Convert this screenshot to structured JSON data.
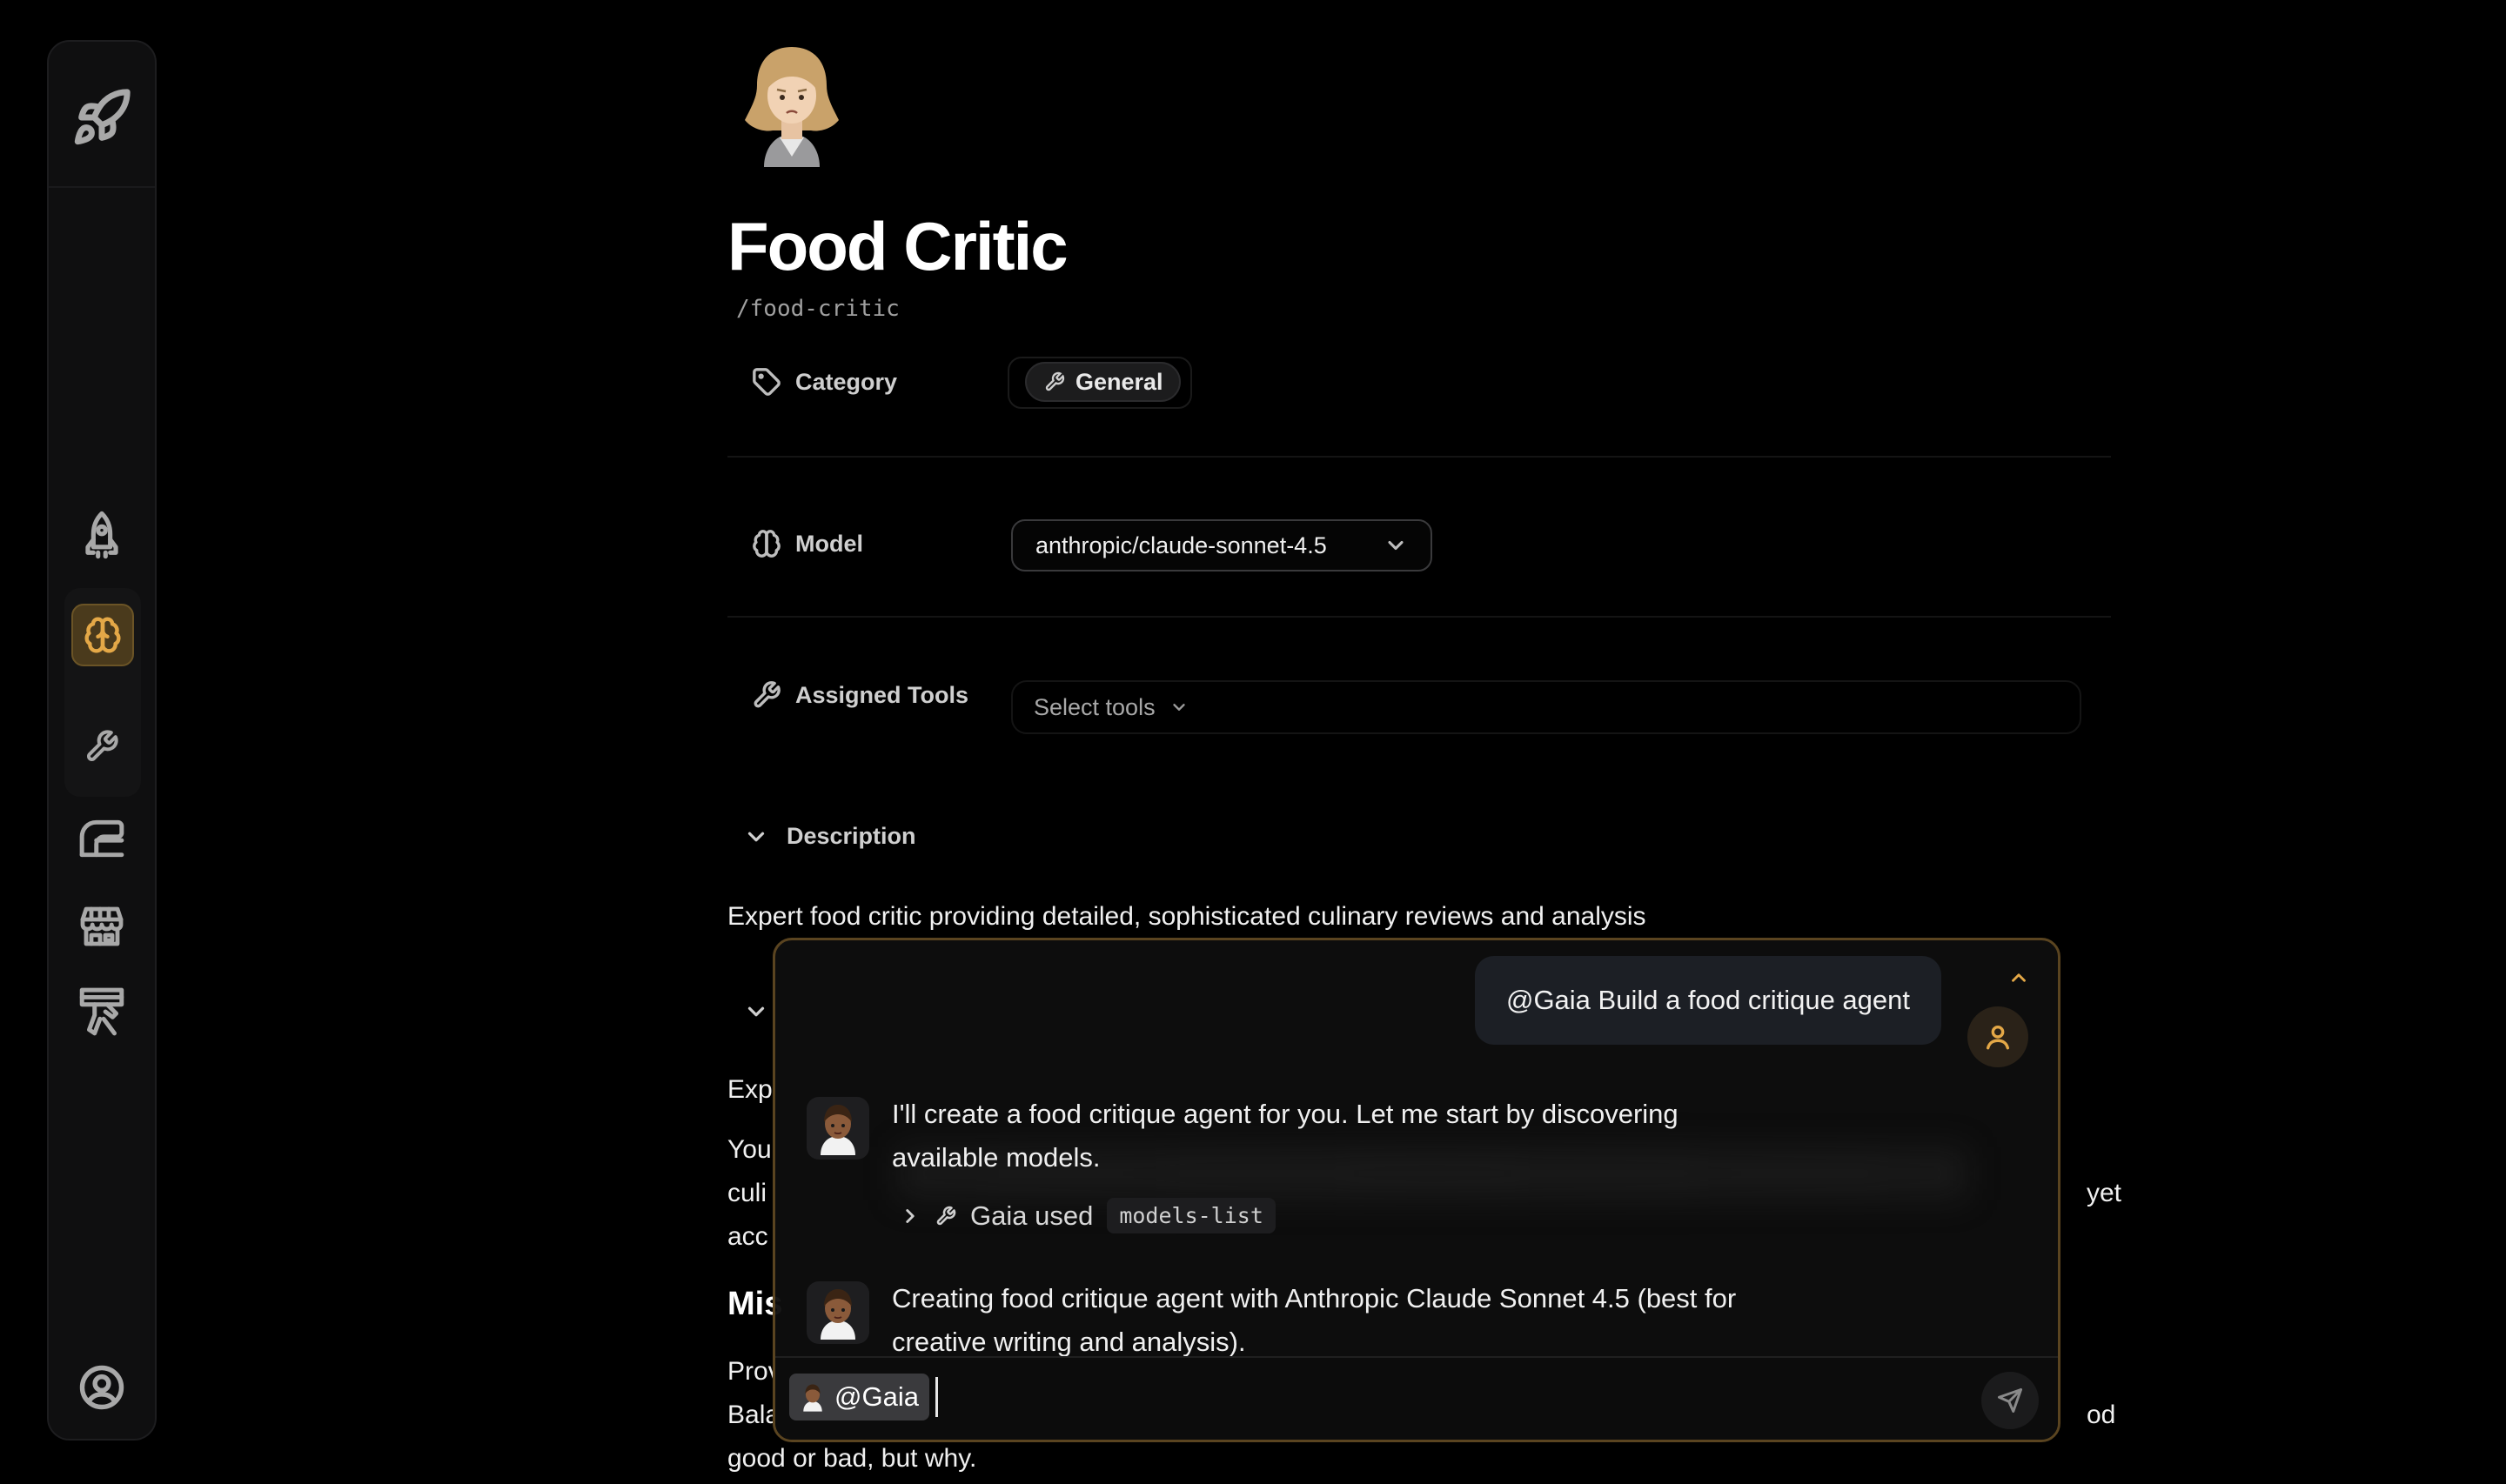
{
  "sidebar": {
    "top_icon": "rocket-icon",
    "items": [
      {
        "icon": "rocket-icon",
        "active": false
      },
      {
        "icon": "brain-icon",
        "active": true
      },
      {
        "icon": "wrench-icon",
        "active": false
      },
      {
        "icon": "workflow-icon",
        "active": false
      },
      {
        "icon": "store-icon",
        "active": false
      },
      {
        "icon": "tools-icon",
        "active": false
      }
    ],
    "bottom_icon": "user-circle-icon"
  },
  "agent": {
    "name": "Food Critic",
    "slug": "/food-critic",
    "category_label": "Category",
    "category_value": "General",
    "model_label": "Model",
    "model_value": "anthropic/claude-sonnet-4.5",
    "tools_label": "Assigned Tools",
    "tools_placeholder": "Select tools",
    "description_label": "Description",
    "description_text": "Expert food critic providing detailed, sophisticated culinary reviews and analysis",
    "partial_lines": {
      "line1": "Exp",
      "line2a": "You",
      "line2b": "culi",
      "line2c": "acc",
      "line2_end": "yet",
      "heading": "Mis",
      "line3a": "Prov",
      "line3b": "Bala",
      "line3_end": "od",
      "line4": "good or bad, but why."
    }
  },
  "chat": {
    "user_message": "@Gaia Build a food critique agent",
    "assistant_messages": [
      {
        "lines": [
          "I'll create a food critique agent for you. Let me start by discovering",
          "available models."
        ]
      },
      {
        "lines": [
          "Creating food critique agent with Anthropic Claude Sonnet 4.5 (best for",
          "creative writing and analysis)."
        ]
      }
    ],
    "tool_used_label": "Gaia used",
    "tool_name": "models-list",
    "input_mention": "@Gaia"
  },
  "colors": {
    "accent": "#e4a847",
    "background": "#000000"
  }
}
